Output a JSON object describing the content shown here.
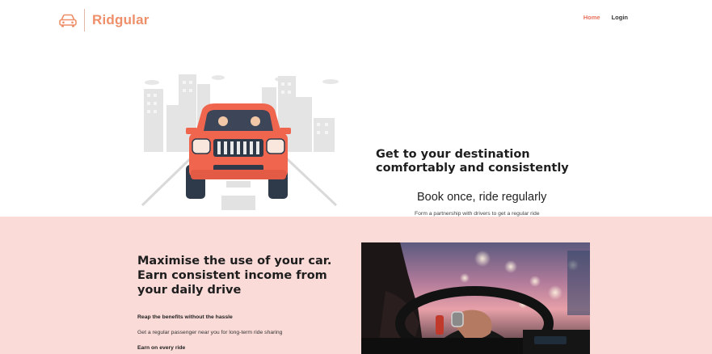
{
  "brand": {
    "name": "Ridgular",
    "icon": "car-outline-icon",
    "color": "#ef8f6a"
  },
  "nav": {
    "home": "Home",
    "login": "Login",
    "active_color": "#e8725d"
  },
  "hero": {
    "title": "Get to your destination comfortably and consistently",
    "subtitle": "Book once, ride regularly",
    "caption": "Form a partnership with drivers to get a regular ride",
    "illustration": "red-suv-city-illustration"
  },
  "drivers": {
    "title": "Maximise the use of your car. Earn consistent income from your daily drive",
    "background": "#fadbd8",
    "benefits": [
      {
        "heading": "Reap the benefits without the hassle",
        "text": "Get a regular passenger near you for long-term ride sharing"
      },
      {
        "heading": "Earn on every ride"
      }
    ],
    "photo": "driver-hands-on-steering-wheel-photo"
  }
}
